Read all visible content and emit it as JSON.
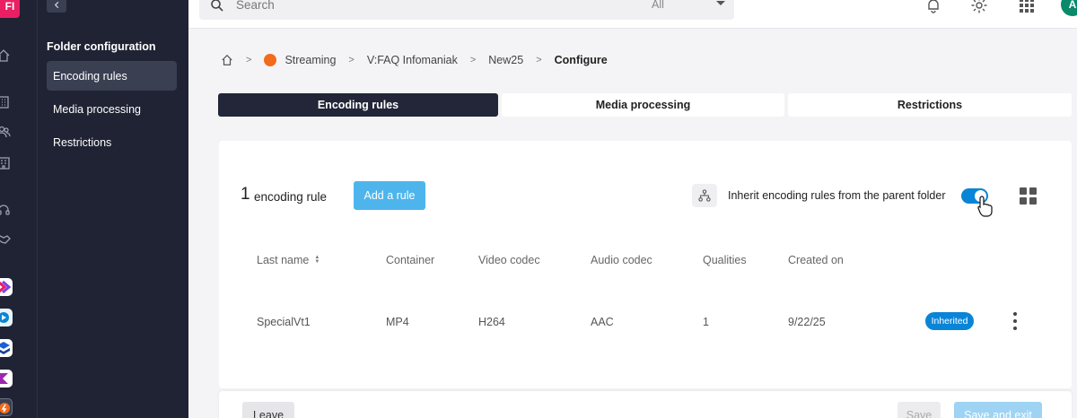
{
  "rail": {
    "account_initials": "FI",
    "icons": [
      "home-icon",
      "building-icon",
      "users-icon",
      "office-icon",
      "headset-icon",
      "handshake-icon"
    ],
    "apps": [
      "app-kchat",
      "app-swisstransfer",
      "app-kdrive",
      "app-kmeet",
      "app-streaming"
    ]
  },
  "sidebar": {
    "title": "Folder configuration",
    "items": [
      {
        "label": "Encoding rules",
        "active": true
      },
      {
        "label": "Media processing",
        "active": false
      },
      {
        "label": "Restrictions",
        "active": false
      }
    ]
  },
  "topbar": {
    "search_placeholder": "Search",
    "search_filter": "All",
    "user_initials": "A"
  },
  "breadcrumb": {
    "items": [
      "Streaming",
      "V:FAQ Infomaniak",
      "New25"
    ],
    "current": "Configure"
  },
  "tabs": [
    {
      "label": "Encoding rules",
      "active": true
    },
    {
      "label": "Media processing",
      "active": false
    },
    {
      "label": "Restrictions",
      "active": false
    }
  ],
  "rules": {
    "count": "1",
    "count_label": "encoding rule",
    "add_button": "Add a rule",
    "inherit_label": "Inherit encoding rules from the parent folder",
    "inherit_enabled": true
  },
  "table": {
    "headers": [
      "Last name",
      "Container",
      "Video codec",
      "Audio codec",
      "Qualities",
      "Created on"
    ],
    "rows": [
      {
        "name": "SpecialVt1",
        "container": "MP4",
        "video": "H264",
        "audio": "AAC",
        "qualities": "1",
        "created": "9/22/25",
        "badge": "Inherited"
      }
    ]
  },
  "footer": {
    "leave": "Leave",
    "save": "Save",
    "save_exit": "Save and exit"
  },
  "colors": {
    "sidebar_bg": "#1f2333",
    "accent": "#0a84d6",
    "add_button": "#4db5ec",
    "brand_pink": "#e91e63"
  }
}
